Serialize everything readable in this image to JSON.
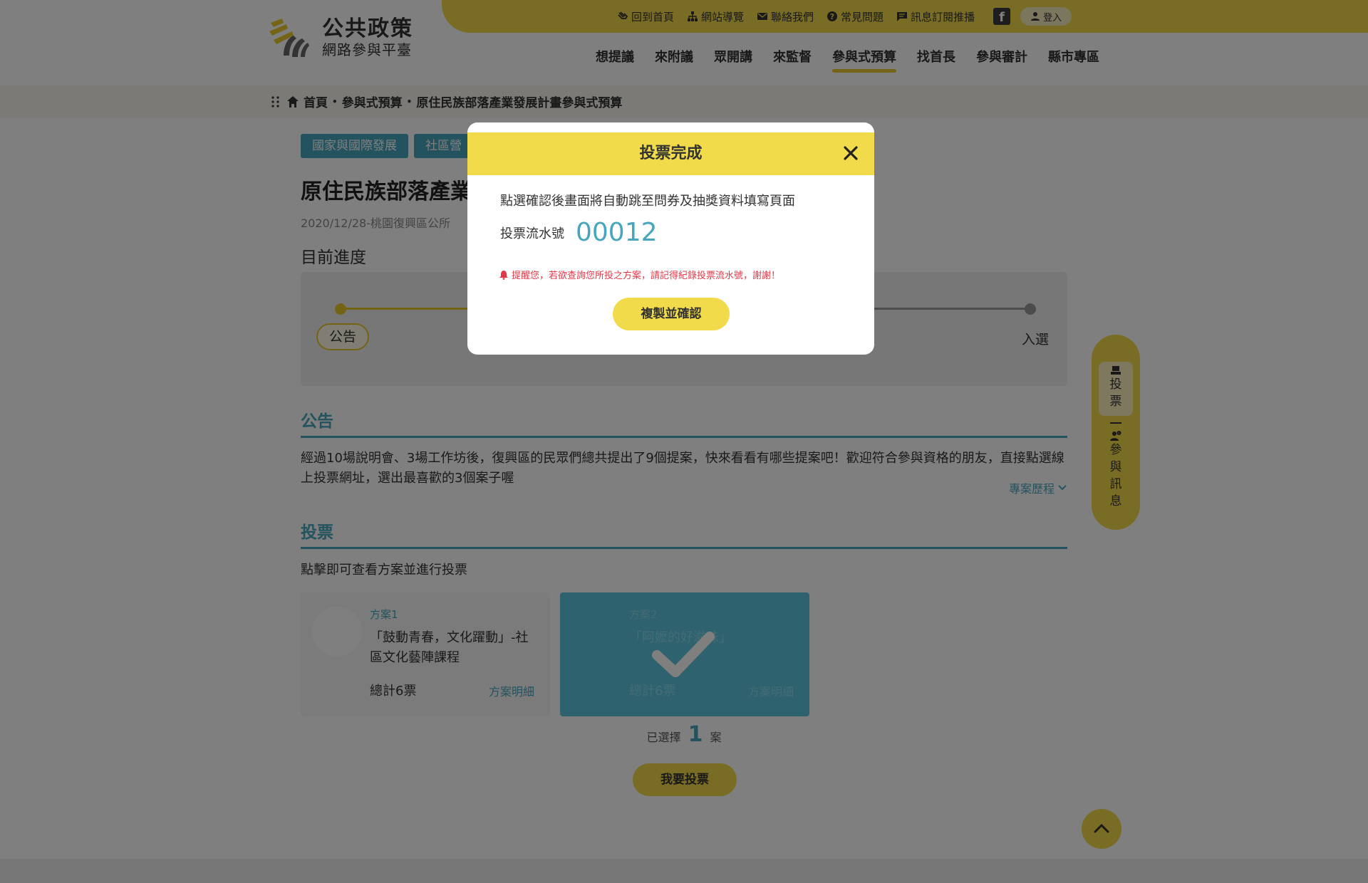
{
  "logo": {
    "title": "公共政策",
    "subtitle": "網路參與平臺"
  },
  "util_nav": {
    "home": "回到首頁",
    "sitemap": "網站導覽",
    "contact": "聯絡我們",
    "faq": "常見問題",
    "subscribe": "訊息訂閱推播",
    "facebook": "f",
    "login": "登入"
  },
  "main_nav": {
    "items": [
      "想提議",
      "來附議",
      "眾開講",
      "來監督",
      "參與式預算",
      "找首長",
      "參與審計",
      "縣市專區"
    ],
    "active_index": 4
  },
  "breadcrumb": {
    "home": "首頁",
    "level1": "參與式預算",
    "level2": "原住民族部落產業發展計畫參與式預算",
    "separator": "•"
  },
  "page": {
    "tags": [
      "國家與國際發展",
      "社區營"
    ],
    "title": "原住民族部落產業",
    "meta": "2020/12/28-桃園復興區公所",
    "progress_title": "目前進度",
    "progress_stage_first": "公告",
    "progress_stage_last": "入選",
    "announce_title": "公告",
    "announce_text": "經過10場說明會、3場工作坊後，復興區的民眾們總共提出了9個提案，快來看看有哪些提案吧！歡迎符合參與資格的朋友，直接點選線上投票網址，選出最喜歡的3個案子喔",
    "history_link": "專案歷程",
    "vote_title": "投票",
    "vote_hint": "點擊即可查看方案並進行投票"
  },
  "cards": [
    {
      "label": "方案1",
      "name": "「鼓動青春，文化躍動」-社區文化藝陣課程",
      "votes": "總計6票",
      "detail": "方案明細",
      "selected": false
    },
    {
      "label": "方案2",
      "name": "「阿嬤的好滋味」",
      "votes": "總計6票",
      "detail": "方案明細",
      "selected": true
    }
  ],
  "selection": {
    "prefix": "已選擇",
    "count": "1",
    "suffix": "案"
  },
  "vote_button": "我要投票",
  "side_float": {
    "vote": [
      "投",
      "票"
    ],
    "info": [
      "參",
      "與",
      "訊",
      "息"
    ]
  },
  "modal": {
    "title": "投票完成",
    "description": "點選確認後畫面將自動跳至問券及抽獎資料填寫頁面",
    "serial_label": "投票流水號",
    "serial_number": "00012",
    "reminder": "提醒您，若欲查詢您所投之方案，請記得紀錄投票流水號，謝謝！",
    "confirm_button": "複製並確認"
  },
  "colors": {
    "accent_yellow": "#f2db4b",
    "accent_teal": "#47a6bd",
    "alert_red": "#e03a4a"
  }
}
